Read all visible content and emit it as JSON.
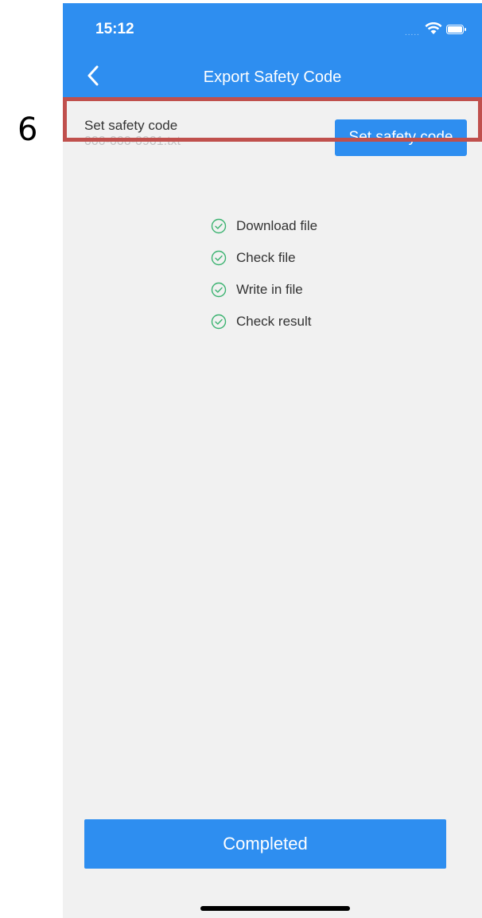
{
  "annotation": {
    "number": "6"
  },
  "status_bar": {
    "time": "15:12",
    "signal": "....."
  },
  "nav": {
    "title": "Export Safety Code"
  },
  "setting": {
    "title": "Set safety code",
    "filename": "000-000-0901.txt",
    "button_label": "Set safety code"
  },
  "steps": [
    {
      "label": "Download file",
      "status": "done",
      "icon": "check-circle-icon"
    },
    {
      "label": "Check file",
      "status": "done",
      "icon": "check-circle-icon"
    },
    {
      "label": "Write in file",
      "status": "done",
      "icon": "check-circle-icon"
    },
    {
      "label": "Check result",
      "status": "done",
      "icon": "check-circle-icon"
    }
  ],
  "footer": {
    "completed_label": "Completed"
  },
  "colors": {
    "primary": "#2e8ef0",
    "background": "#f1f1f1",
    "success": "#3cb371",
    "highlight": "#c0504d"
  }
}
